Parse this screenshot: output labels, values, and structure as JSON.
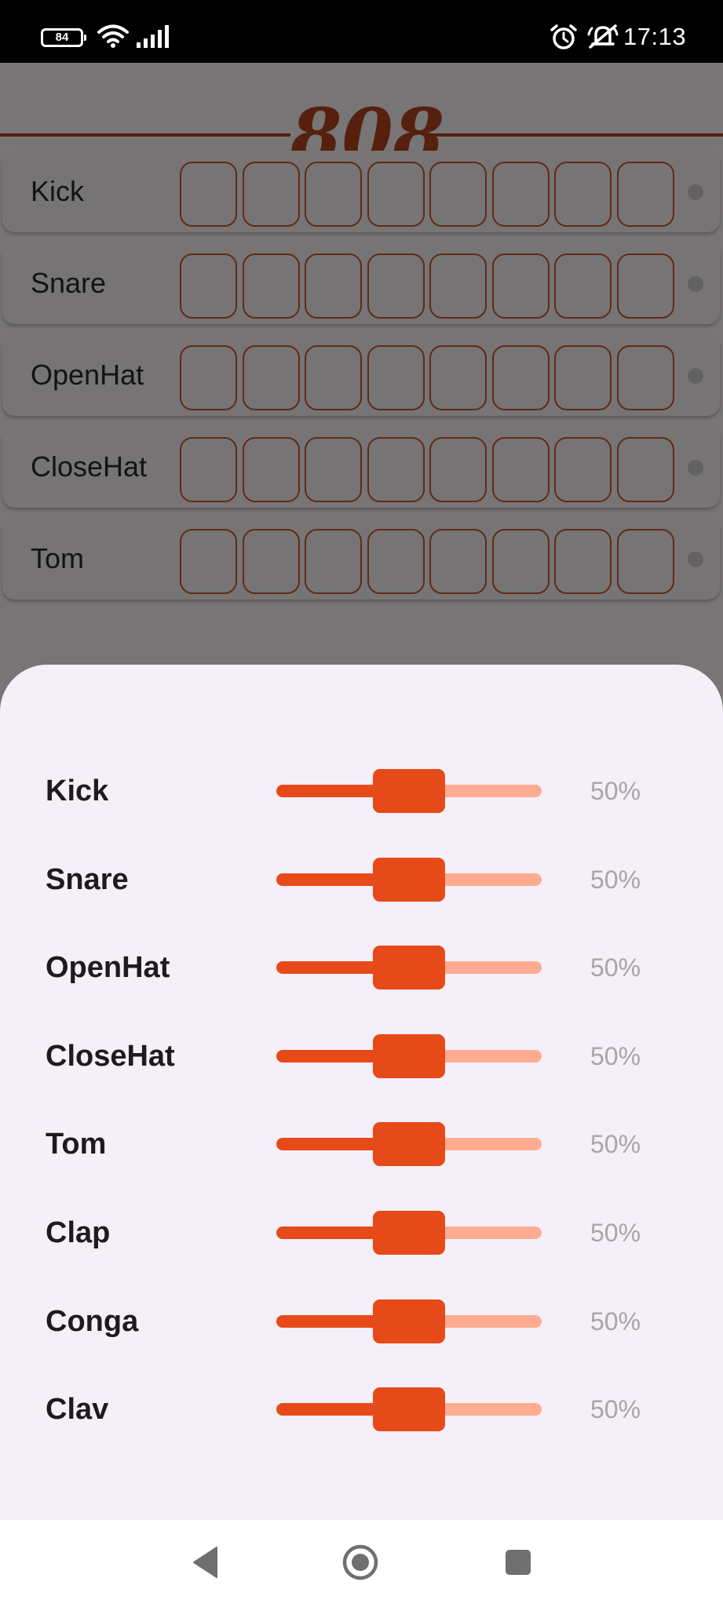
{
  "status_bar": {
    "battery": "84",
    "time": "17:13",
    "icons": [
      "battery-icon",
      "wifi-icon",
      "signal-icon",
      "alarm-icon",
      "notifications-off-icon"
    ]
  },
  "app": {
    "logo": "808",
    "accent_color": "#b5441f",
    "tracks": [
      {
        "name": "Kick"
      },
      {
        "name": "Snare"
      },
      {
        "name": "OpenHat"
      },
      {
        "name": "CloseHat"
      },
      {
        "name": "Tom"
      }
    ],
    "steps_per_track": 8
  },
  "volume_sheet": {
    "slider_color": "#e64a19",
    "channels": [
      {
        "name": "Kick",
        "value": "50%",
        "level": 0.5
      },
      {
        "name": "Snare",
        "value": "50%",
        "level": 0.5
      },
      {
        "name": "OpenHat",
        "value": "50%",
        "level": 0.5
      },
      {
        "name": "CloseHat",
        "value": "50%",
        "level": 0.5
      },
      {
        "name": "Tom",
        "value": "50%",
        "level": 0.5
      },
      {
        "name": "Clap",
        "value": "50%",
        "level": 0.5
      },
      {
        "name": "Conga",
        "value": "50%",
        "level": 0.5
      },
      {
        "name": "Clav",
        "value": "50%",
        "level": 0.5
      }
    ]
  },
  "nav_bar": {
    "icons": [
      "back-icon",
      "home-icon",
      "recents-icon"
    ]
  }
}
